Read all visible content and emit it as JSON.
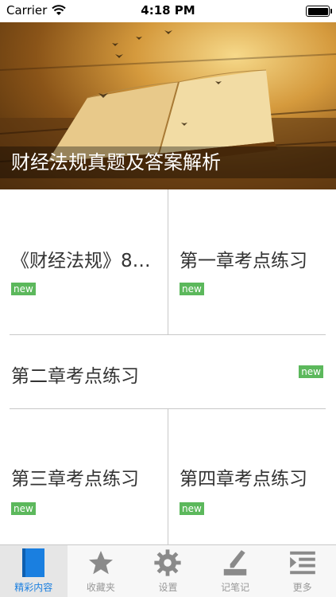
{
  "status_bar": {
    "carrier": "Carrier",
    "time": "4:18 PM"
  },
  "banner": {
    "title": "财经法规真题及答案解析"
  },
  "grid": {
    "items": [
      {
        "label": "《财经法规》8…",
        "badge": "new"
      },
      {
        "label": "第一章考点练习",
        "badge": "new"
      },
      {
        "label": "第二章考点练习",
        "badge": "new"
      },
      {
        "label": "第三章考点练习",
        "badge": "new"
      },
      {
        "label": "第四章考点练习",
        "badge": "new"
      }
    ]
  },
  "tabbar": {
    "tabs": [
      {
        "label": "精彩内容",
        "icon": "bookmark-icon",
        "active": true
      },
      {
        "label": "收藏夹",
        "icon": "star-icon",
        "active": false
      },
      {
        "label": "设置",
        "icon": "gear-icon",
        "active": false
      },
      {
        "label": "记笔记",
        "icon": "pen-icon",
        "active": false
      },
      {
        "label": "更多",
        "icon": "list-icon",
        "active": false
      }
    ]
  },
  "colors": {
    "accent": "#1a7fe0",
    "badge": "#5cb85c",
    "divider": "#c8c8c8"
  }
}
